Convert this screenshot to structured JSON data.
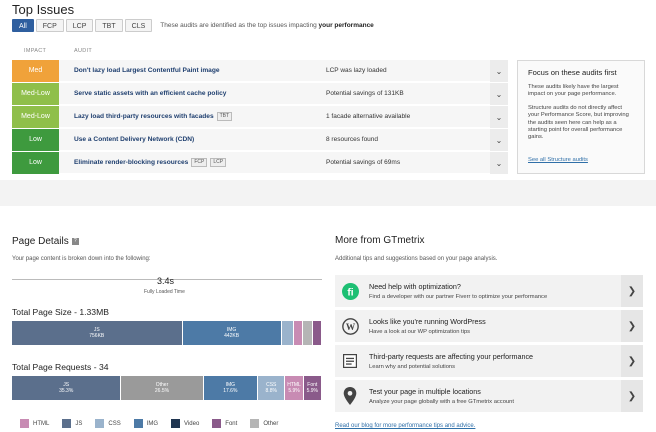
{
  "top_issues": {
    "title": "Top Issues",
    "filters": [
      "All",
      "FCP",
      "LCP",
      "TBT",
      "CLS"
    ],
    "filter_desc_prefix": "These audits are identified as the top issues impacting ",
    "filter_desc_bold": "your performance",
    "col_impact": "IMPACT",
    "col_audit": "AUDIT",
    "audits": [
      {
        "impact": "Med",
        "color": "#f0a23a",
        "title": "Don't lazy load Largest Contentful Paint image",
        "tags": [],
        "value": "LCP was lazy loaded"
      },
      {
        "impact": "Med-Low",
        "color": "#8fbf4a",
        "title": "Serve static assets with an efficient cache policy",
        "tags": [],
        "value": "Potential savings of 131KB"
      },
      {
        "impact": "Med-Low",
        "color": "#8fbf4a",
        "title": "Lazy load third-party resources with facades",
        "tags": [
          "TBT"
        ],
        "value": "1 facade alternative available"
      },
      {
        "impact": "Low",
        "color": "#3e9a3e",
        "title": "Use a Content Delivery Network (CDN)",
        "tags": [],
        "value": "8 resources found"
      },
      {
        "impact": "Low",
        "color": "#3e9a3e",
        "title": "Eliminate render-blocking resources",
        "tags": [
          "FCP",
          "LCP"
        ],
        "value": "Potential savings of 69ms"
      }
    ],
    "focus": {
      "title": "Focus on these audits first",
      "p1": "These audits likely have the largest impact on your page performance.",
      "p2": "Structure audits do not directly affect your Performance Score, but improving the audits seen here can help as a starting point for overall performance gains.",
      "link": "See all Structure audits"
    }
  },
  "page_details": {
    "title": "Page Details",
    "help": "?",
    "subtitle": "Your page content is broken down into the following:",
    "loaded_time": "3.4s",
    "loaded_label": "Fully Loaded Time",
    "size_title": "Total Page Size - 1.33MB",
    "size_segments": [
      {
        "label": "JS",
        "value": "756KB",
        "fraction": 0.55,
        "color": "#5b6f8c"
      },
      {
        "label": "IMG",
        "value": "442KB",
        "fraction": 0.32,
        "color": "#4d7aa6"
      },
      {
        "label": "",
        "value": "",
        "fraction": 0.04,
        "color": "#9ab3cc"
      },
      {
        "label": "",
        "value": "",
        "fraction": 0.03,
        "color": "#c88bb3"
      },
      {
        "label": "",
        "value": "",
        "fraction": 0.03,
        "color": "#b5b5b5"
      },
      {
        "label": "",
        "value": "",
        "fraction": 0.03,
        "color": "#8a5a8a"
      }
    ],
    "requests_title": "Total Page Requests - 34",
    "request_segments": [
      {
        "label": "JS",
        "value": "35.3%",
        "fraction": 0.353,
        "color": "#5b6f8c"
      },
      {
        "label": "Other",
        "value": "26.5%",
        "fraction": 0.265,
        "color": "#9a9a9a"
      },
      {
        "label": "IMG",
        "value": "17.6%",
        "fraction": 0.176,
        "color": "#4d7aa6"
      },
      {
        "label": "CSS",
        "value": "8.8%",
        "fraction": 0.088,
        "color": "#9ab3cc"
      },
      {
        "label": "HTML",
        "value": "5.9%",
        "fraction": 0.059,
        "color": "#c88bb3"
      },
      {
        "label": "Font",
        "value": "5.9%",
        "fraction": 0.059,
        "color": "#8a5a8a"
      }
    ],
    "legend": [
      {
        "name": "HTML",
        "color": "#c88bb3"
      },
      {
        "name": "JS",
        "color": "#5b6f8c"
      },
      {
        "name": "CSS",
        "color": "#9ab3cc"
      },
      {
        "name": "IMG",
        "color": "#4d7aa6"
      },
      {
        "name": "Video",
        "color": "#1f3550"
      },
      {
        "name": "Font",
        "color": "#8a5a8a"
      },
      {
        "name": "Other",
        "color": "#b5b5b5"
      }
    ]
  },
  "more": {
    "title": "More from GTmetrix",
    "subtitle": "Additional tips and suggestions based on your page analysis.",
    "cards": [
      {
        "icon": "fiverr-icon",
        "title": "Need help with optimization?",
        "desc": "Find a developer with our partner Fiverr to optimize your performance"
      },
      {
        "icon": "wordpress-icon",
        "title": "Looks like you're running WordPress",
        "desc": "Have a look at our WP optimization tips"
      },
      {
        "icon": "document-icon",
        "title": "Third-party requests are affecting your performance",
        "desc": "Learn why and potential solutions"
      },
      {
        "icon": "location-pin-icon",
        "title": "Test your page in multiple locations",
        "desc": "Analyze your page globally with a free GTmetrix account"
      }
    ],
    "blog_link": "Read our blog for more performance tips and advice."
  }
}
